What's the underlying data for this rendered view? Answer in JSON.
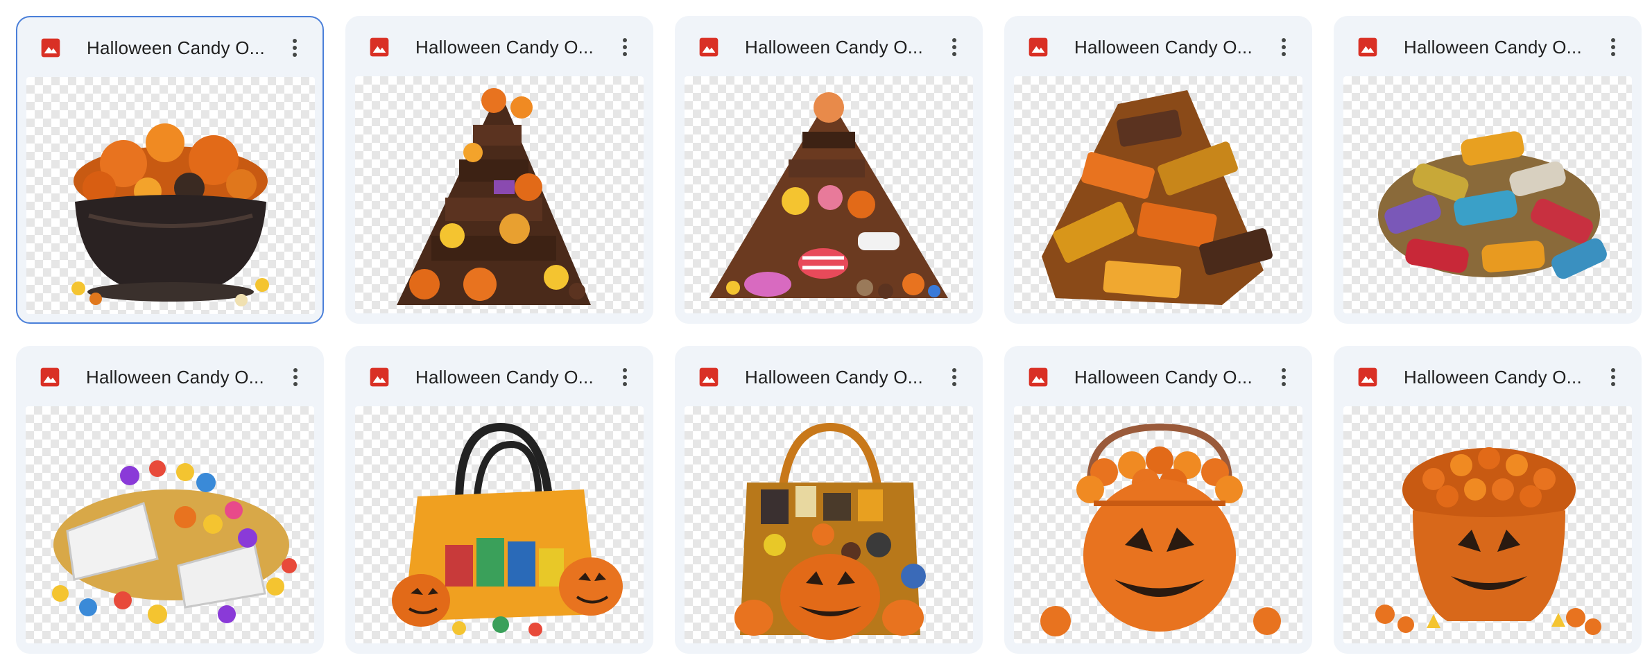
{
  "files": [
    {
      "title": "Halloween Candy O...",
      "file_icon": "image-file-icon",
      "menu_icon": "more-vert-icon",
      "selected": true,
      "thumbnail": "candy-in-black-bowl"
    },
    {
      "title": "Halloween Candy O...",
      "file_icon": "image-file-icon",
      "menu_icon": "more-vert-icon",
      "selected": false,
      "thumbnail": "chocolate-candy-tower"
    },
    {
      "title": "Halloween Candy O...",
      "file_icon": "image-file-icon",
      "menu_icon": "more-vert-icon",
      "selected": false,
      "thumbnail": "mixed-candy-pyramid"
    },
    {
      "title": "Halloween Candy O...",
      "file_icon": "image-file-icon",
      "menu_icon": "more-vert-icon",
      "selected": false,
      "thumbnail": "wrapped-chocolate-pile"
    },
    {
      "title": "Halloween Candy O...",
      "file_icon": "image-file-icon",
      "menu_icon": "more-vert-icon",
      "selected": false,
      "thumbnail": "foil-wrapped-candy-pile"
    },
    {
      "title": "Halloween Candy O...",
      "file_icon": "image-file-icon",
      "menu_icon": "more-vert-icon",
      "selected": false,
      "thumbnail": "jellybeans-and-pillows"
    },
    {
      "title": "Halloween Candy O...",
      "file_icon": "image-file-icon",
      "menu_icon": "more-vert-icon",
      "selected": false,
      "thumbnail": "orange-tote-with-pumpkins"
    },
    {
      "title": "Halloween Candy O...",
      "file_icon": "image-file-icon",
      "menu_icon": "more-vert-icon",
      "selected": false,
      "thumbnail": "jack-o-lantern-candy-bag"
    },
    {
      "title": "Halloween Candy O...",
      "file_icon": "image-file-icon",
      "menu_icon": "more-vert-icon",
      "selected": false,
      "thumbnail": "pumpkin-bucket-small-pumpkins"
    },
    {
      "title": "Halloween Candy O...",
      "file_icon": "image-file-icon",
      "menu_icon": "more-vert-icon",
      "selected": false,
      "thumbnail": "pumpkin-bucket-candy-corn"
    }
  ],
  "colors": {
    "card_bg": "#f0f4f9",
    "selected_border": "#4a7fd9",
    "image_icon_red": "#d93025",
    "title_text": "#1f1f1f",
    "menu_dots": "#444746"
  }
}
